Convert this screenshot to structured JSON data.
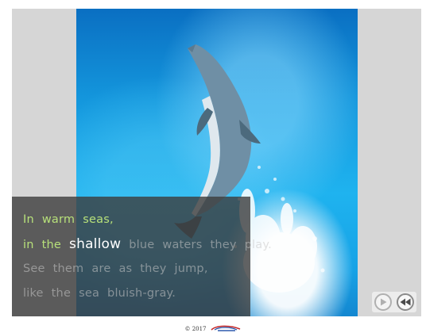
{
  "caption": {
    "lines": [
      {
        "words": [
          {
            "text": "In",
            "state": "read"
          },
          {
            "text": "warm",
            "state": "read"
          },
          {
            "text": "seas,",
            "state": "read"
          }
        ]
      },
      {
        "words": [
          {
            "text": "in",
            "state": "read"
          },
          {
            "text": "the",
            "state": "read"
          },
          {
            "text": "shallow",
            "state": "current"
          },
          {
            "text": "blue",
            "state": "unread"
          },
          {
            "text": "waters",
            "state": "unread"
          },
          {
            "text": "they",
            "state": "unread"
          },
          {
            "text": "play.",
            "state": "unread"
          }
        ]
      },
      {
        "words": [
          {
            "text": "See",
            "state": "unread"
          },
          {
            "text": "them",
            "state": "unread"
          },
          {
            "text": "are",
            "state": "unread"
          },
          {
            "text": "as",
            "state": "unread"
          },
          {
            "text": "they",
            "state": "unread"
          },
          {
            "text": "jump,",
            "state": "unread"
          }
        ]
      },
      {
        "words": [
          {
            "text": "like",
            "state": "unread"
          },
          {
            "text": "the",
            "state": "unread"
          },
          {
            "text": "sea",
            "state": "unread"
          },
          {
            "text": "bluish-gray.",
            "state": "unread"
          }
        ]
      }
    ]
  },
  "illustration": {
    "subject": "dolphin-jumping-from-water"
  },
  "controls": {
    "play_icon": "play-icon",
    "rewind_icon": "rewind-icon"
  },
  "footer": {
    "copyright": "© 2017",
    "logo_text": "AsiaEnglish.com"
  },
  "colors": {
    "read_word": "#b7e07a",
    "current_word": "#ffffff",
    "unread_word": "#c8c8c8",
    "frame_bg": "#d6d6d6"
  }
}
